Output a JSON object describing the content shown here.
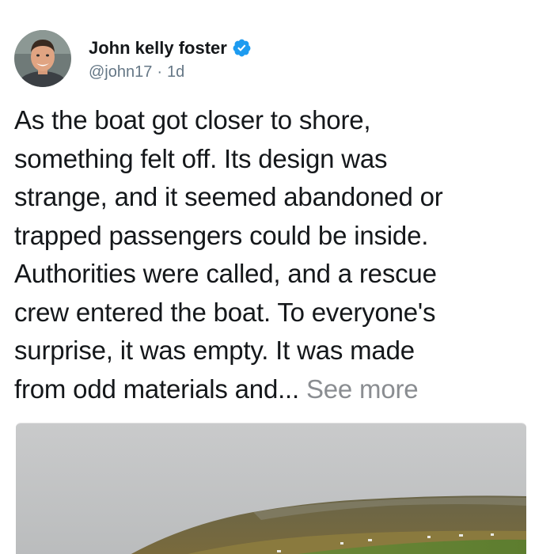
{
  "author": {
    "name": "John kelly foster",
    "handle": "@john17",
    "separator": "·",
    "time": "1d",
    "verified": true,
    "avatar_icon": "profile-photo"
  },
  "post": {
    "text": "As the boat got closer to shore,\nsomething felt off. Its design was\nstrange, and it seemed abandoned or\ntrapped passengers could be inside.\nAuthorities were called, and a rescue\ncrew entered the boat. To everyone's\nsurprise, it was empty. It was made\nfrom odd materials and... ",
    "see_more": "See more"
  },
  "media": {
    "type": "photo",
    "description_icon": "landscape-photo"
  },
  "colors": {
    "text": "#14171a",
    "secondary": "#657786",
    "see_more": "#8a8d91",
    "verified": "#1d9bf0"
  }
}
